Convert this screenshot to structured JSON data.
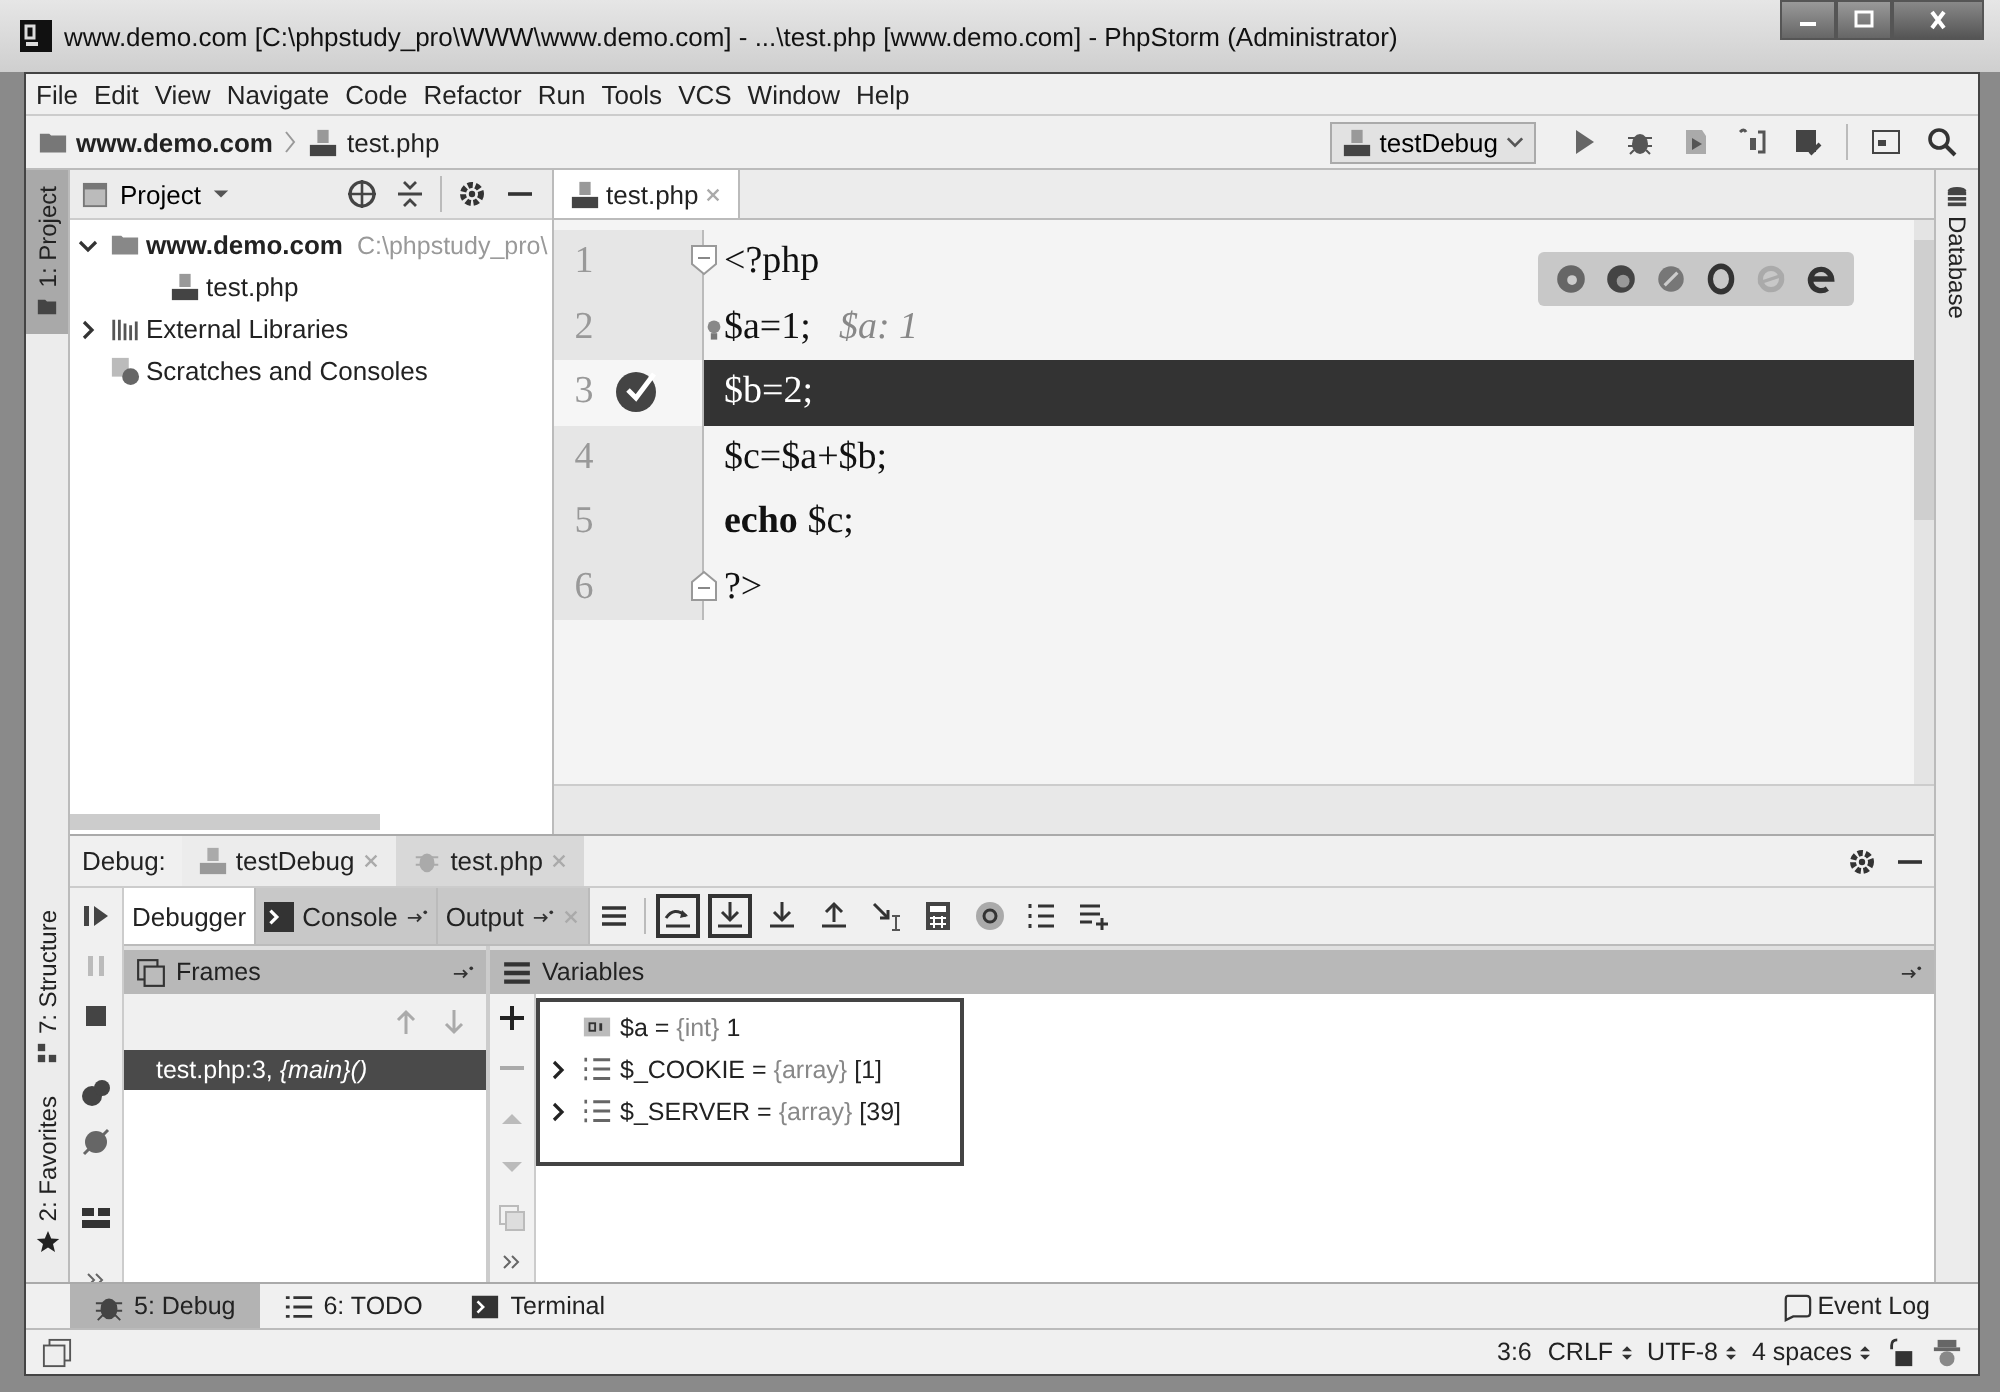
{
  "window": {
    "title": "www.demo.com [C:\\phpstudy_pro\\WWW\\www.demo.com] - ...\\test.php [www.demo.com] - PhpStorm (Administrator)"
  },
  "menu": [
    "File",
    "Edit",
    "View",
    "Navigate",
    "Code",
    "Refactor",
    "Run",
    "Tools",
    "VCS",
    "Window",
    "Help"
  ],
  "breadcrumb": [
    {
      "kind": "folder",
      "label": "www.demo.com"
    },
    {
      "kind": "php",
      "label": "test.php"
    }
  ],
  "run_config": {
    "label": "testDebug"
  },
  "left_stripe": [
    {
      "kind": "folder",
      "label": "1: Project",
      "selected": true
    },
    {
      "kind": "structure",
      "label": "7: Structure",
      "selected": false
    },
    {
      "kind": "star",
      "label": "2: Favorites",
      "selected": false
    }
  ],
  "project": {
    "title": "Project",
    "tree": [
      {
        "kind": "folder",
        "label": "www.demo.com",
        "hint": "C:\\phpstudy_pro\\",
        "expanded": true,
        "children": [
          {
            "kind": "php",
            "label": "test.php"
          }
        ]
      },
      {
        "kind": "libraries",
        "label": "External Libraries",
        "expanded": false
      },
      {
        "kind": "scratches",
        "label": "Scratches and Consoles"
      }
    ]
  },
  "editor": {
    "tabs": [
      {
        "label": "test.php",
        "selected": true
      }
    ],
    "lines": [
      {
        "number": "1",
        "code": "<?php",
        "current": false,
        "breakpoint": false,
        "bulb": false
      },
      {
        "number": "2",
        "code": "$a=1;",
        "hint": "$a: 1",
        "current": false,
        "breakpoint": false,
        "bulb": true
      },
      {
        "number": "3",
        "code": "$b=2;",
        "current": true,
        "breakpoint": true,
        "bulb": false
      },
      {
        "number": "4",
        "code": "$c=$a+$b;",
        "current": false,
        "breakpoint": false,
        "bulb": false
      },
      {
        "number": "5",
        "code": "**echo** $c;",
        "current": false,
        "breakpoint": false,
        "bulb": false
      },
      {
        "number": "6",
        "code": "?>",
        "current": false,
        "breakpoint": false,
        "bulb": false
      }
    ]
  },
  "right_stripe": [
    {
      "label": "Database"
    }
  ],
  "debug": {
    "label": "Debug:",
    "sessions": [
      {
        "kind": "php",
        "label": "testDebug",
        "selected": true
      },
      {
        "kind": "bug",
        "label": "test.php",
        "selected": false
      }
    ],
    "tabs": [
      {
        "kind": "plain",
        "label": "Debugger",
        "selected": true
      },
      {
        "kind": "console",
        "label": "Console",
        "selected": false
      },
      {
        "kind": "output",
        "label": "Output",
        "selected": false
      }
    ],
    "toolbar": [
      {
        "kind": "show-execution",
        "outlined": true
      },
      {
        "kind": "step-over",
        "outlined": true
      },
      {
        "kind": "step-into",
        "outlined": false
      },
      {
        "kind": "step-out",
        "outlined": false
      },
      {
        "kind": "run-to-cursor",
        "outlined": false
      },
      {
        "kind": "evaluate",
        "outlined": false
      },
      {
        "kind": "watch",
        "outlined": false
      },
      {
        "kind": "list",
        "outlined": false
      },
      {
        "kind": "add",
        "outlined": false
      }
    ],
    "frames": {
      "title": "Frames",
      "items": [
        {
          "label": "test.php:3, *{main}()*",
          "selected": true
        }
      ]
    },
    "variables": {
      "title": "Variables",
      "outlined": true,
      "items": [
        {
          "kind": "int",
          "name": "$a =",
          "type": "{int}",
          "value": "1",
          "expandable": false
        },
        {
          "kind": "array",
          "name": "$_COOKIE =",
          "type": "{array}",
          "value": "[1]",
          "expandable": true
        },
        {
          "kind": "array",
          "name": "$_SERVER =",
          "type": "{array}",
          "value": "[39]",
          "expandable": true
        }
      ]
    }
  },
  "tool_tabs": [
    {
      "kind": "bug",
      "label": "5: Debug",
      "selected": true
    },
    {
      "kind": "todo",
      "label": "6: TODO",
      "selected": false
    },
    {
      "kind": "terminal",
      "label": "Terminal",
      "selected": false
    }
  ],
  "event_log": "Event Log",
  "status": [
    {
      "label": "3:6",
      "dropdown": false
    },
    {
      "label": "CRLF",
      "dropdown": true
    },
    {
      "label": "UTF-8",
      "dropdown": true
    },
    {
      "label": "4 spaces",
      "dropdown": true
    }
  ]
}
